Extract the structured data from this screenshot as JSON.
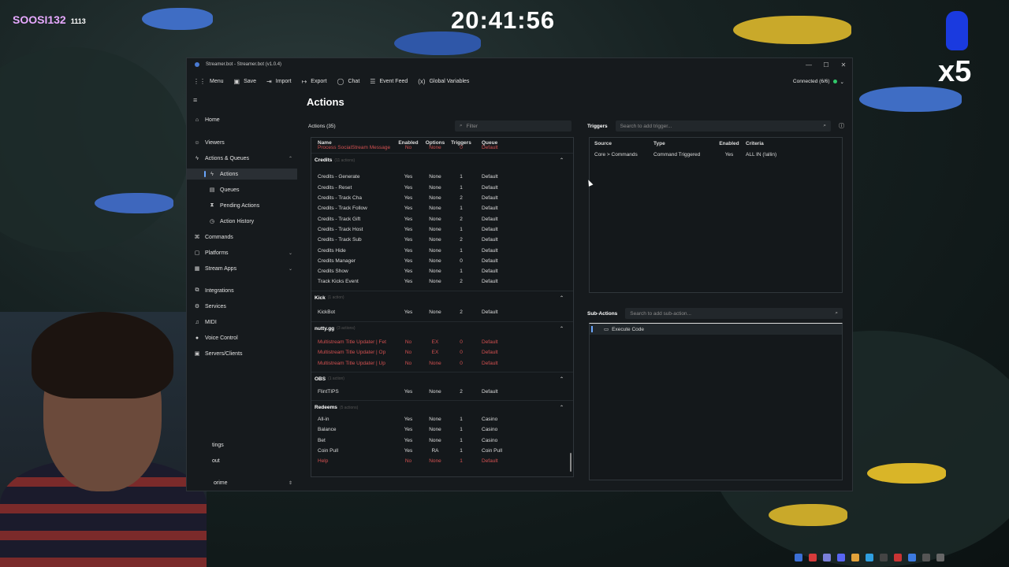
{
  "overlay": {
    "username": "SOOSI132",
    "user_count": "1113",
    "clock": "20:41:56",
    "multiplier": "x5"
  },
  "window": {
    "title": "Streamer.bot - Streamer.bot (v1.0.4)",
    "min_glyph": "—",
    "max_glyph": "☐",
    "close_glyph": "✕"
  },
  "toolbar": {
    "menu": "Menu",
    "save": "Save",
    "import": "Import",
    "export": "Export",
    "chat": "Chat",
    "event_feed": "Event Feed",
    "global_variables": "Global Variables",
    "connection": "Connected (6/6)"
  },
  "sidebar": {
    "home": "Home",
    "viewers": "Viewers",
    "actions_queues": "Actions & Queues",
    "actions": "Actions",
    "queues": "Queues",
    "pending_actions": "Pending Actions",
    "action_history": "Action History",
    "commands": "Commands",
    "platforms": "Platforms",
    "stream_apps": "Stream Apps",
    "integrations": "Integrations",
    "services": "Services",
    "midi": "MIDI",
    "voice_control": "Voice Control",
    "servers_clients": "Servers/Clients",
    "settings": "tings",
    "about": "out",
    "supporters": "orime"
  },
  "main": {
    "title": "Actions"
  },
  "actions_panel": {
    "label": "Actions (35)",
    "filter_placeholder": "Filter",
    "columns": {
      "name": "Name",
      "enabled": "Enabled",
      "options": "Options",
      "triggers": "Triggers",
      "queue": "Queue"
    },
    "top_row": {
      "name": "Process SocialStream Message",
      "enabled": "No",
      "options": "None",
      "triggers": "0",
      "queue": "Default"
    },
    "groups": {
      "credits": {
        "name": "Credits",
        "count": "(11 actions)"
      },
      "kick": {
        "name": "Kick",
        "count": "(1 action)"
      },
      "nutty": {
        "name": "nutty.gg",
        "count": "(3 actions)"
      },
      "obs": {
        "name": "OBS",
        "count": "(1 action)"
      },
      "redeems": {
        "name": "Redeems",
        "count": "(5 actions)"
      }
    },
    "credits_rows": [
      {
        "name": "Credits - Generate",
        "enabled": "Yes",
        "options": "None",
        "triggers": "1",
        "queue": "Default"
      },
      {
        "name": "Credits - Reset",
        "enabled": "Yes",
        "options": "None",
        "triggers": "1",
        "queue": "Default"
      },
      {
        "name": "Credits - Track Cha",
        "enabled": "Yes",
        "options": "None",
        "triggers": "2",
        "queue": "Default"
      },
      {
        "name": "Credits - Track Follow",
        "enabled": "Yes",
        "options": "None",
        "triggers": "1",
        "queue": "Default"
      },
      {
        "name": "Credits - Track Gift",
        "enabled": "Yes",
        "options": "None",
        "triggers": "2",
        "queue": "Default"
      },
      {
        "name": "Credits - Track Host",
        "enabled": "Yes",
        "options": "None",
        "triggers": "1",
        "queue": "Default"
      },
      {
        "name": "Credits - Track Sub",
        "enabled": "Yes",
        "options": "None",
        "triggers": "2",
        "queue": "Default"
      },
      {
        "name": "Credits Hide",
        "enabled": "Yes",
        "options": "None",
        "triggers": "1",
        "queue": "Default"
      },
      {
        "name": "Credits Manager",
        "enabled": "Yes",
        "options": "None",
        "triggers": "0",
        "queue": "Default"
      },
      {
        "name": "Credits Show",
        "enabled": "Yes",
        "options": "None",
        "triggers": "1",
        "queue": "Default"
      },
      {
        "name": "Track Kicks Event",
        "enabled": "Yes",
        "options": "None",
        "triggers": "2",
        "queue": "Default"
      }
    ],
    "kick_rows": [
      {
        "name": "KickBot",
        "enabled": "Yes",
        "options": "None",
        "triggers": "2",
        "queue": "Default"
      }
    ],
    "nutty_rows": [
      {
        "name": "Multistream Title Updater | Fet",
        "enabled": "No",
        "options": "EX",
        "triggers": "0",
        "queue": "Default"
      },
      {
        "name": "Multistream Title Updater | Op",
        "enabled": "No",
        "options": "EX",
        "triggers": "0",
        "queue": "Default"
      },
      {
        "name": "Multistream Title Updater | Up",
        "enabled": "No",
        "options": "None",
        "triggers": "0",
        "queue": "Default"
      }
    ],
    "obs_rows": [
      {
        "name": "FlintTIPS",
        "enabled": "Yes",
        "options": "None",
        "triggers": "2",
        "queue": "Default"
      }
    ],
    "redeems_rows": [
      {
        "name": "All-in",
        "enabled": "Yes",
        "options": "None",
        "triggers": "1",
        "queue": "Casino"
      },
      {
        "name": "Balance",
        "enabled": "Yes",
        "options": "None",
        "triggers": "1",
        "queue": "Casino"
      },
      {
        "name": "Bet",
        "enabled": "Yes",
        "options": "None",
        "triggers": "1",
        "queue": "Casino"
      },
      {
        "name": "Coin Pull",
        "enabled": "Yes",
        "options": "RA",
        "triggers": "1",
        "queue": "Coin Pull"
      },
      {
        "name": "Help",
        "enabled": "No",
        "options": "None",
        "triggers": "1",
        "queue": "Default"
      }
    ]
  },
  "triggers_panel": {
    "label": "Triggers",
    "search_placeholder": "Search to add trigger...",
    "columns": {
      "source": "Source",
      "type": "Type",
      "enabled": "Enabled",
      "criteria": "Criteria"
    },
    "rows": [
      {
        "source": "Core > Commands",
        "type": "Command Triggered",
        "enabled": "Yes",
        "criteria": "ALL IN (!allin)"
      }
    ]
  },
  "subactions_panel": {
    "label": "Sub-Actions",
    "search_placeholder": "Search to add sub-action...",
    "items": [
      {
        "label": "Execute Code"
      }
    ]
  }
}
